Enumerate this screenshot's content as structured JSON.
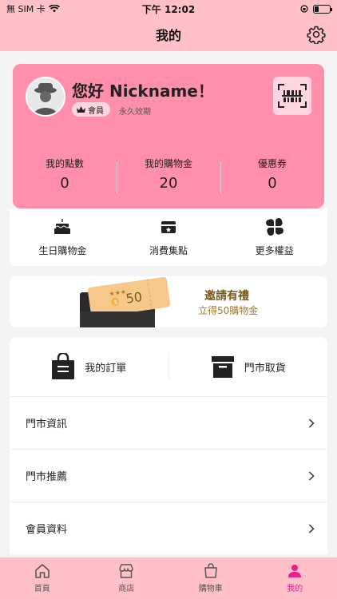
{
  "status_bar": {
    "carrier": "無 SIM 卡",
    "time": "下午 12:02"
  },
  "nav": {
    "title": "我的"
  },
  "member": {
    "greeting": "您好 Nickname！",
    "badge": "會員",
    "validity": "永久效期",
    "stats": [
      {
        "label": "我的點數",
        "value": "0"
      },
      {
        "label": "我的購物金",
        "value": "20"
      },
      {
        "label": "優惠券",
        "value": "0"
      }
    ]
  },
  "benefits": [
    {
      "label": "生日購物金",
      "icon": "cake-icon"
    },
    {
      "label": "消費集點",
      "icon": "stamp-icon"
    },
    {
      "label": "更多權益",
      "icon": "grid-icon"
    }
  ],
  "invite": {
    "title": "邀請有禮",
    "subtitle": "立得50購物金",
    "coupon_value": "50"
  },
  "orders": [
    {
      "label": "我的訂單",
      "icon": "shopping-bag-icon"
    },
    {
      "label": "門市取貨",
      "icon": "store-pickup-icon"
    }
  ],
  "menu": [
    {
      "label": "門市資訊"
    },
    {
      "label": "門市推薦"
    },
    {
      "label": "會員資料"
    }
  ],
  "tabs": [
    {
      "label": "首頁",
      "icon": "home-icon"
    },
    {
      "label": "商店",
      "icon": "shop-icon"
    },
    {
      "label": "購物車",
      "icon": "cart-icon"
    },
    {
      "label": "我的",
      "icon": "person-icon"
    }
  ],
  "colors": {
    "header": "#ffc0c8",
    "card": "#ff8fab",
    "active_tab": "#e91e8c",
    "invite_gold": "#7a5a1a"
  }
}
